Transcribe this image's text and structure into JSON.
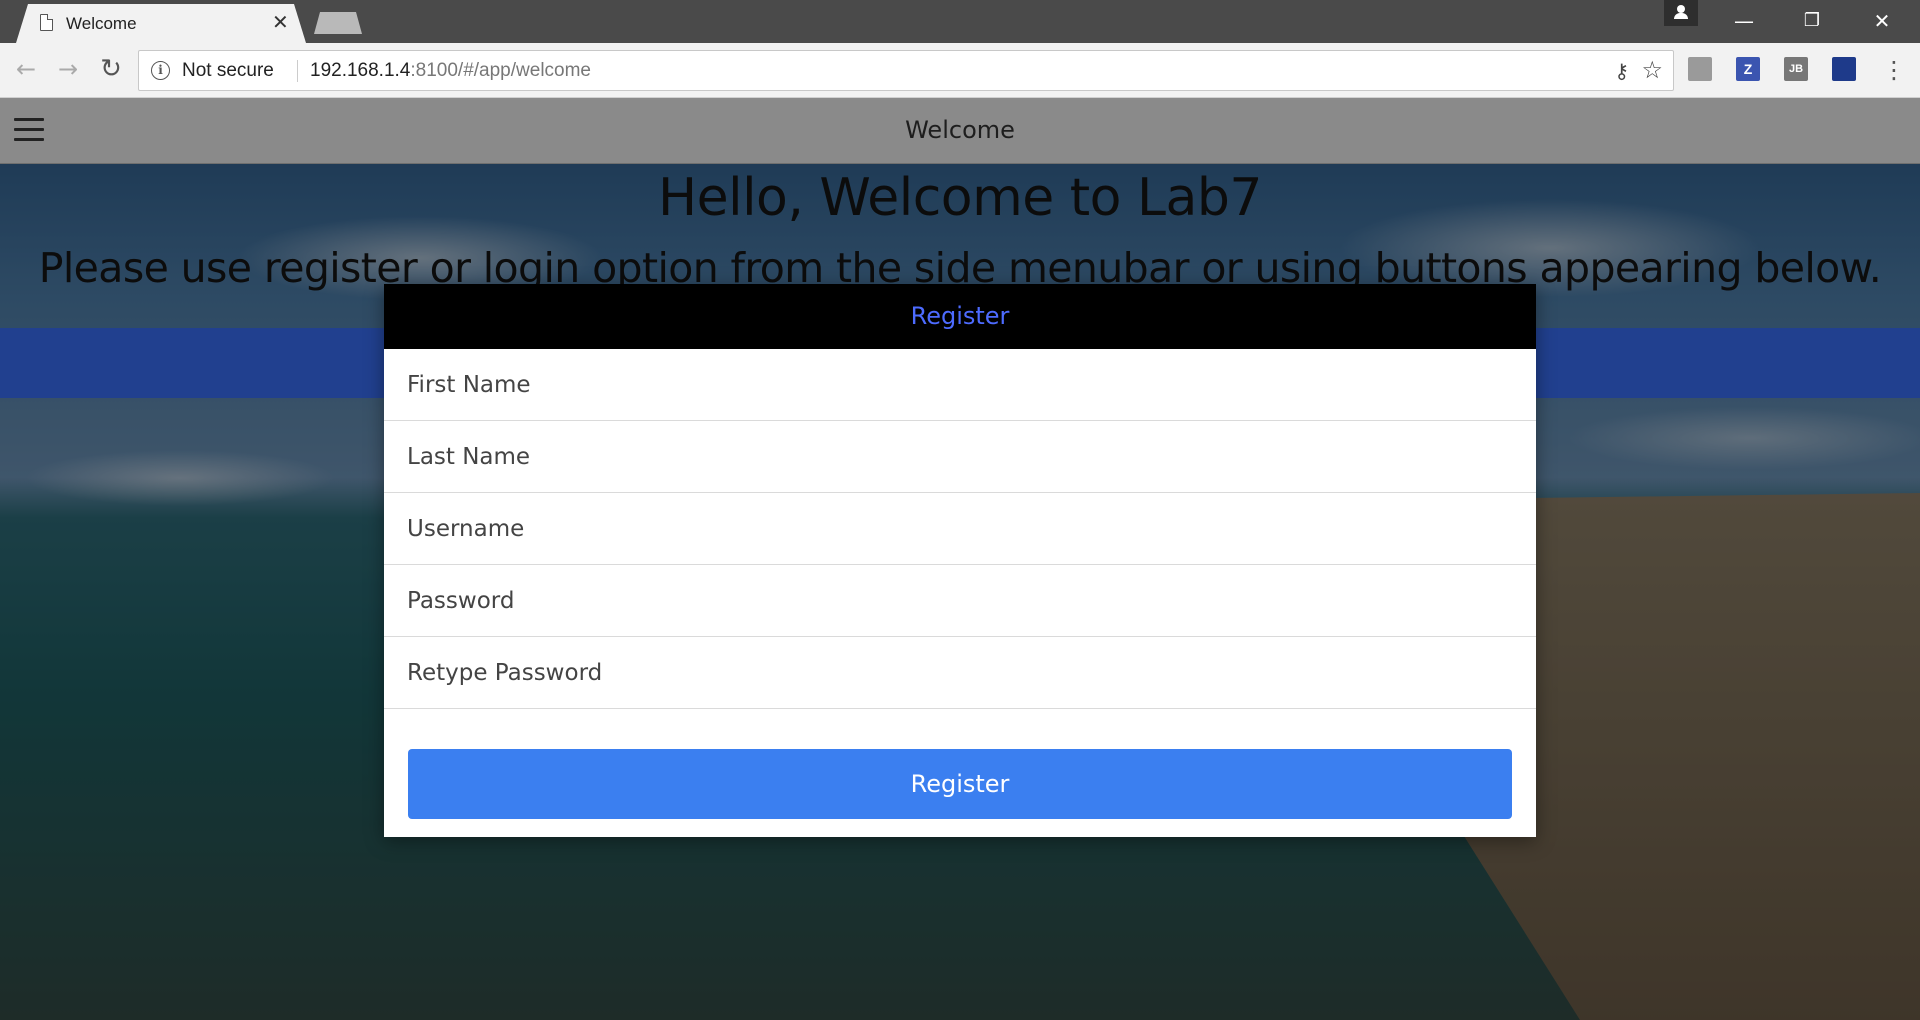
{
  "browser": {
    "tab": {
      "title": "Welcome",
      "close": "✕"
    },
    "window_controls": {
      "minimize": "—",
      "restore": "❐",
      "close": "✕"
    },
    "nav": {
      "back": "←",
      "forward": "→",
      "reload": "↻"
    },
    "omnibox": {
      "security_label": "Not secure",
      "info_symbol": "i",
      "url_host": "192.168.1.4",
      "url_rest": ":8100/#/app/welcome"
    },
    "extensions": [
      {
        "name": "acrobat-extension-icon",
        "label": "",
        "color": "#9a9a9a"
      },
      {
        "name": "zotero-extension-icon",
        "label": "Z",
        "color": "#3b55b0"
      },
      {
        "name": "jetbrains-extension-icon",
        "label": "JB",
        "color": "#777777"
      },
      {
        "name": "flag-extension-icon",
        "label": "",
        "color": "#1e3a8a"
      }
    ],
    "menu_symbol": "⋮"
  },
  "app": {
    "header_title": "Welcome",
    "heading": "Hello, Welcome to Lab7",
    "instructions": "Please use register or login option from the side menubar or using buttons appearing below.",
    "colors": {
      "accent_bar": "#21408f",
      "primary_button": "#3b7ff0",
      "modal_title": "#4d6bff"
    }
  },
  "modal": {
    "title": "Register",
    "fields": [
      {
        "placeholder": "First Name"
      },
      {
        "placeholder": "Last Name"
      },
      {
        "placeholder": "Username"
      },
      {
        "placeholder": "Password"
      },
      {
        "placeholder": "Retype Password"
      }
    ],
    "submit_label": "Register"
  }
}
